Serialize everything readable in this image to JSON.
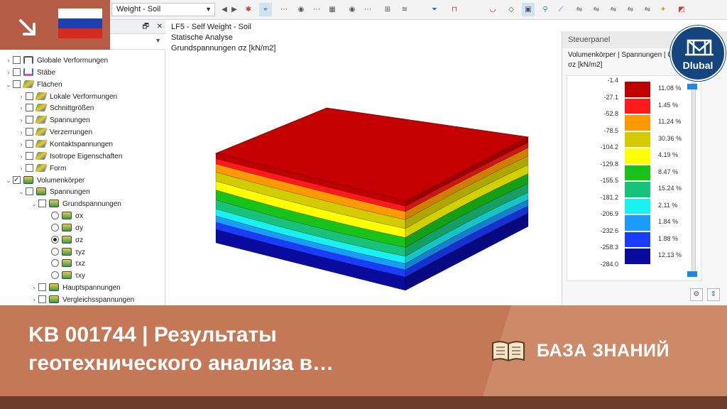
{
  "toolbar": {
    "loadcase_combo": "Weight - Soil"
  },
  "navigator": {
    "items": [
      {
        "label": "Globale Verformungen",
        "level": 0,
        "expand": "closed",
        "checked": false,
        "icon": "frame-icon"
      },
      {
        "label": "Stäbe",
        "level": 0,
        "expand": "closed",
        "checked": false,
        "icon": "member-icon"
      },
      {
        "label": "Flächen",
        "level": 0,
        "expand": "open",
        "checked": false,
        "icon": "surface-icon"
      },
      {
        "label": "Lokale Verformungen",
        "level": 1,
        "expand": "closed",
        "checked": false,
        "icon": "surface-icon"
      },
      {
        "label": "Schnittgrößen",
        "level": 1,
        "expand": "closed",
        "checked": false,
        "icon": "surface-icon"
      },
      {
        "label": "Spannungen",
        "level": 1,
        "expand": "closed",
        "checked": false,
        "icon": "surface-icon"
      },
      {
        "label": "Verzerrungen",
        "level": 1,
        "expand": "closed",
        "checked": false,
        "icon": "surface-icon"
      },
      {
        "label": "Kontaktspannungen",
        "level": 1,
        "expand": "closed",
        "checked": false,
        "icon": "surface-icon"
      },
      {
        "label": "Isotrope Eigenschaften",
        "level": 1,
        "expand": "closed",
        "checked": false,
        "icon": "surface-icon"
      },
      {
        "label": "Form",
        "level": 1,
        "expand": "closed",
        "checked": false,
        "icon": "surface-icon"
      },
      {
        "label": "Volumenkörper",
        "level": 0,
        "expand": "open",
        "checked": true,
        "icon": "solid-icon"
      },
      {
        "label": "Spannungen",
        "level": 1,
        "expand": "open",
        "checked": false,
        "icon": "solid-icon"
      },
      {
        "label": "Grundspannungen",
        "level": 2,
        "expand": "open",
        "checked": false,
        "icon": "solid-icon"
      },
      {
        "label": "σx",
        "level": 3,
        "radio": true,
        "selected": false,
        "icon": "solid-icon"
      },
      {
        "label": "σy",
        "level": 3,
        "radio": true,
        "selected": false,
        "icon": "solid-icon"
      },
      {
        "label": "σz",
        "level": 3,
        "radio": true,
        "selected": true,
        "icon": "solid-icon"
      },
      {
        "label": "τyz",
        "level": 3,
        "radio": true,
        "selected": false,
        "icon": "solid-icon"
      },
      {
        "label": "τxz",
        "level": 3,
        "radio": true,
        "selected": false,
        "icon": "solid-icon"
      },
      {
        "label": "τxy",
        "level": 3,
        "radio": true,
        "selected": false,
        "icon": "solid-icon"
      },
      {
        "label": "Hauptspannungen",
        "level": 2,
        "expand": "closed",
        "checked": false,
        "icon": "solid-icon"
      },
      {
        "label": "Vergleichsspannungen",
        "level": 2,
        "expand": "closed",
        "checked": false,
        "icon": "solid-icon"
      }
    ]
  },
  "viewport": {
    "line1": "LF5 - Self Weight - Soil",
    "line2": "Statische Analyse",
    "line3": "Grundspannungen σz [kN/m2]"
  },
  "panel": {
    "title": "Steuerpanel",
    "subtitle": "Volumenkörper | Spannungen | Gr",
    "unit": "σz [kN/m2]",
    "legend": {
      "values": [
        "-1.4",
        "-27.1",
        "-52.8",
        "-78.5",
        "-104.2",
        "-129.8",
        "-155.5",
        "-181.2",
        "-206.9",
        "-232.6",
        "-258.3",
        "-284.0"
      ],
      "bands": [
        {
          "color": "#c00000",
          "percent": "11.08 %"
        },
        {
          "color": "#ff1a1a",
          "percent": "1.45 %"
        },
        {
          "color": "#ff9900",
          "percent": "11.24 %"
        },
        {
          "color": "#d4cc00",
          "percent": "30.36 %"
        },
        {
          "color": "#ffff00",
          "percent": "4.19 %"
        },
        {
          "color": "#19c219",
          "percent": "8.47 %"
        },
        {
          "color": "#19c27a",
          "percent": "15.24 %"
        },
        {
          "color": "#19f0f0",
          "percent": "2.11 %"
        },
        {
          "color": "#1a9cff",
          "percent": "1.84 %"
        },
        {
          "color": "#1a3cff",
          "percent": "1.88 %"
        },
        {
          "color": "#0a0a9c",
          "percent": "12.13 %"
        }
      ]
    }
  },
  "logo": {
    "text": "Dlubal"
  },
  "banner": {
    "title": "KB 001744 | Результаты геотехнического анализа в…",
    "label": "БАЗА ЗНАНИЙ"
  },
  "colors": {
    "banner": "#c47857",
    "banner_footer": "#6f3b29",
    "logo": "#14457e",
    "accent": "#1e88e5"
  }
}
